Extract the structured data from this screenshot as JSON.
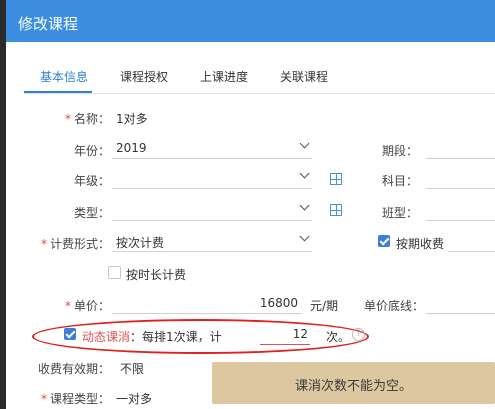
{
  "dialog": {
    "title": "修改课程"
  },
  "tabs": [
    {
      "label": "基本信息"
    },
    {
      "label": "课程授权"
    },
    {
      "label": "上课进度"
    },
    {
      "label": "关联课程"
    }
  ],
  "form": {
    "name": {
      "label": "名称：",
      "value": "1对多"
    },
    "year": {
      "label": "年份：",
      "value": "2019"
    },
    "term": {
      "label": "期段："
    },
    "grade": {
      "label": "年级："
    },
    "subject": {
      "label": "科目："
    },
    "type": {
      "label": "类型："
    },
    "class_type": {
      "label": "班型："
    },
    "fee_form": {
      "label": "计费形式：",
      "value": "按次计费"
    },
    "by_term": {
      "label": "按期收费",
      "checked": true
    },
    "by_duration": {
      "label": "按时长计费",
      "checked": false
    },
    "unit_price": {
      "label": "单价：",
      "value": "16800",
      "unit": "元/期"
    },
    "floor_price": {
      "label": "单价底线："
    },
    "dynamic": {
      "label": "动态课消",
      "desc": "：每排1次课，计",
      "count": "12",
      "unit": "次。",
      "checked": true
    },
    "validity": {
      "label": "收费有效期：",
      "value": "不限"
    },
    "course_type": {
      "label": "课程类型：",
      "value": "一对多"
    }
  },
  "toast": {
    "message": "课消次数不能为空。"
  },
  "icons": {
    "grade_icon": "grid-icon",
    "type_icon": "grid-icon",
    "help": "question-circle-icon"
  },
  "colors": {
    "header": "#3d8ee0",
    "accent": "#2d7fd3",
    "required": "#e64545",
    "annotation": "#e0201e",
    "toast": "#dcc7a0"
  }
}
